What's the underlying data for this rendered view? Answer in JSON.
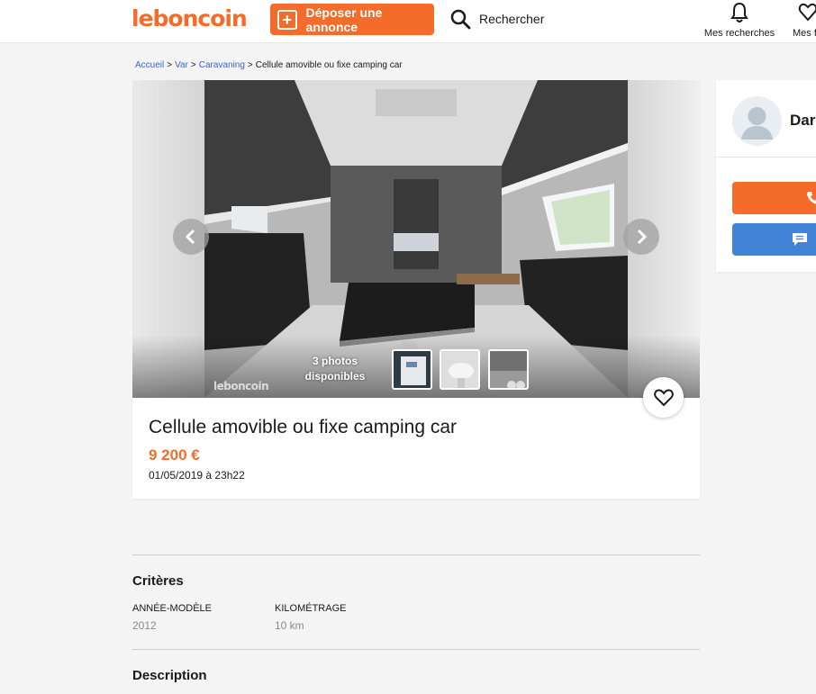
{
  "header": {
    "logo": "leboncoin",
    "post_button": "Déposer une annonce",
    "search_label": "Rechercher",
    "saved_searches_label": "Mes recherches",
    "favorites_label_partial": "Mes f"
  },
  "breadcrumb": {
    "items": [
      "Accueil",
      "Var",
      "Caravaning"
    ],
    "current": "Cellule amovible ou fixe camping car"
  },
  "gallery": {
    "photo_count_line1": "3 photos",
    "photo_count_line2": "disponibles",
    "watermark": "leboncoin"
  },
  "ad": {
    "title": "Cellule amovible ou fixe camping car",
    "price": "9 200 €",
    "date": "01/05/2019 à 23h22"
  },
  "criteria": {
    "title": "Critères",
    "items": [
      {
        "label": "Année-modèle",
        "value": "2012"
      },
      {
        "label": "Kilométrage",
        "value": "10 km"
      }
    ]
  },
  "description": {
    "title": "Description"
  },
  "seller": {
    "name_partial": "Dar"
  },
  "colors": {
    "brand": "#f56b2a",
    "link": "#3a67c2",
    "message_button": "#4183d7"
  }
}
